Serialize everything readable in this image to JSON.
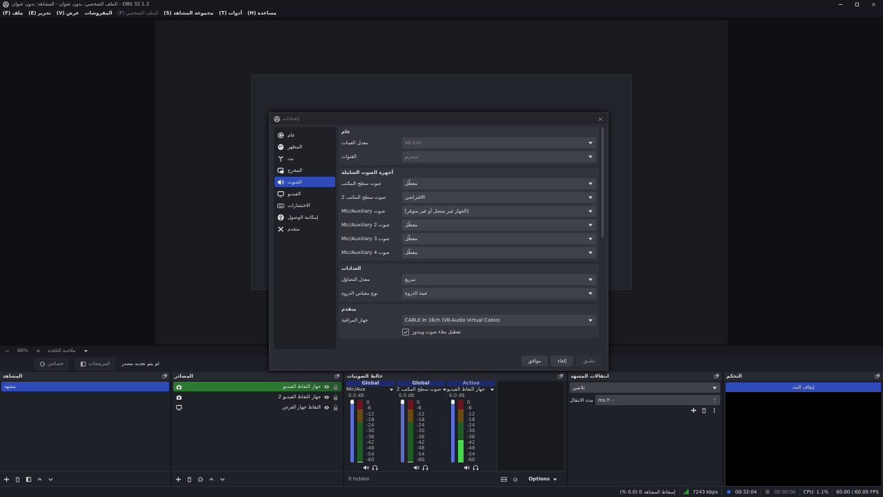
{
  "window": {
    "title": "OBS 32.1.2 - الملف الشخصي: بدون عنوان - المشاهد: بدون عنوان"
  },
  "menu": [
    {
      "label": "مساعدة (H)",
      "disabled": false
    },
    {
      "label": "أدوات (T)",
      "disabled": false
    },
    {
      "label": "مجموعة المشاهد (S)",
      "disabled": false
    },
    {
      "label": "الملف الشخصي (P)",
      "disabled": true
    },
    {
      "label": "المفروشات",
      "disabled": false
    },
    {
      "label": "عرض (V)",
      "disabled": false
    },
    {
      "label": "تحرير (E)",
      "disabled": false
    },
    {
      "label": "ملف (F)",
      "disabled": false
    }
  ],
  "preview_bar": {
    "zoom": "86%",
    "mode": "ملاءمة النافذة"
  },
  "source_toolbar": {
    "status": "لم يتم تحديد مصدر",
    "buttons": [
      {
        "label": "المرشحات",
        "kind": "filter"
      },
      {
        "label": "خصائص",
        "kind": "gear"
      }
    ]
  },
  "settings": {
    "title": "إعدادات",
    "nav": [
      {
        "label": "عام",
        "kind": "general",
        "selected": false
      },
      {
        "label": "المظهر",
        "kind": "appearance",
        "selected": false
      },
      {
        "label": "بث",
        "kind": "stream",
        "selected": false
      },
      {
        "label": "المخرج",
        "kind": "output",
        "selected": false
      },
      {
        "label": "الصوت",
        "kind": "audio",
        "selected": true
      },
      {
        "label": "الفيديو",
        "kind": "video",
        "selected": false
      },
      {
        "label": "الاختصارات",
        "kind": "hotkeys",
        "selected": false
      },
      {
        "label": "إمكانية الوصول",
        "kind": "accessibility",
        "selected": false
      },
      {
        "label": "متقدم",
        "kind": "advanced",
        "selected": false
      }
    ],
    "sections": [
      {
        "title": "عام",
        "rows": [
          {
            "label": "معدل العينات",
            "value": "48 kHz",
            "disabled": true
          },
          {
            "label": "القنوات",
            "value": "ستيريو",
            "disabled": true
          }
        ]
      },
      {
        "title": "أجهزة الصوت الشاملة",
        "rows": [
          {
            "label": "صوت سطح المكتب",
            "value": "معطّل",
            "disabled": false
          },
          {
            "label": "صوت سطح المكتب 2",
            "value": "الافتراضي",
            "disabled": false
          },
          {
            "label": "صوت Mic/Auxiliary",
            "value": "[الجهاز غير متصل أو غير متوفر]",
            "disabled": false
          },
          {
            "label": "صوت Mic/Auxiliary 2",
            "value": "معطّل",
            "disabled": false
          },
          {
            "label": "صوت Mic/Auxiliary 3",
            "value": "معطّل",
            "disabled": false
          },
          {
            "label": "صوت Mic/Auxiliary 4",
            "value": "معطّل",
            "disabled": false
          }
        ]
      },
      {
        "title": "العدادات",
        "rows": [
          {
            "label": "معدل التضاؤل",
            "value": "سريع",
            "disabled": false
          },
          {
            "label": "نوع مقياس الذروة",
            "value": "عينة الذروة",
            "disabled": false
          }
        ]
      },
      {
        "title": "متقدم",
        "rows": [
          {
            "label": "جهاز المراقبة",
            "value": "CABLE In 16ch (VB-Audio Virtual Cable)",
            "disabled": false
          }
        ],
        "checkbox": {
          "label": "تعطيل بطء صوت ويندوز",
          "checked": true
        }
      }
    ],
    "buttons": [
      {
        "label": "تطبيق",
        "disabled": true
      },
      {
        "label": "إلغاء",
        "disabled": false
      },
      {
        "label": "موافق",
        "disabled": false
      }
    ]
  },
  "scenes": {
    "title": "المشاهد",
    "items": [
      {
        "label": "مشهد",
        "selected": true
      }
    ]
  },
  "sources": {
    "title": "المصادر",
    "items": [
      {
        "label": "جهاز التقاط الفيديو",
        "kind": "camera",
        "selected": true
      },
      {
        "label": "جهاز التقاط الفيديو 2",
        "kind": "camera",
        "selected": false
      },
      {
        "label": "التقاط جهاز العرض",
        "kind": "display",
        "selected": false
      }
    ]
  },
  "mixer": {
    "title": "خالط الصوتيات",
    "channels": [
      {
        "scope": "Active",
        "name": "جهاز التقاط الفيديو",
        "db": "0.0 dB",
        "volume": {
          "level": 1
        },
        "meter": {
          "level": 0.34
        },
        "scale": [
          "0",
          "-6",
          "-12",
          "-18",
          "-24",
          "-30",
          "-36",
          "-42",
          "-48",
          "-54",
          "-60"
        ]
      },
      {
        "scope": "Global",
        "name": "صوت سطح المكتب 2",
        "db": "0.0 dB",
        "volume": {
          "level": 1
        },
        "meter": {
          "level": 0
        },
        "scale": [
          "0",
          "-6",
          "-12",
          "-18",
          "-24",
          "-30",
          "-36",
          "-42",
          "-48",
          "-54",
          "-60"
        ]
      },
      {
        "scope": "Global",
        "name": "Mic/Aux",
        "db": "0.0 dB",
        "volume": {
          "level": 1
        },
        "meter": {
          "level": 0
        },
        "scale": [
          "0",
          "-6",
          "-12",
          "-18",
          "-24",
          "-30",
          "-36",
          "-42",
          "-48",
          "-54",
          "-60"
        ]
      }
    ],
    "hidden": "0 hidden",
    "options": "Options"
  },
  "transitions": {
    "title": "انتقالات المشهد",
    "type": "تلاشي",
    "duration_label": "مدة الانتقال",
    "duration": "٣٠٠ ms"
  },
  "controls": {
    "title": "التحكم",
    "buttons": [
      {
        "label": "إيقاف البث",
        "active": true
      }
    ]
  },
  "status_bar": {
    "dropped": "إسقاط المشاهد 0 (0.0 %)",
    "bitrate": "7243 kbps",
    "stream_time": "00:32:04",
    "record_time": "00:00:00",
    "cpu": "CPU: 1.1%",
    "fps": "60.00 / 60.00 FPS"
  }
}
